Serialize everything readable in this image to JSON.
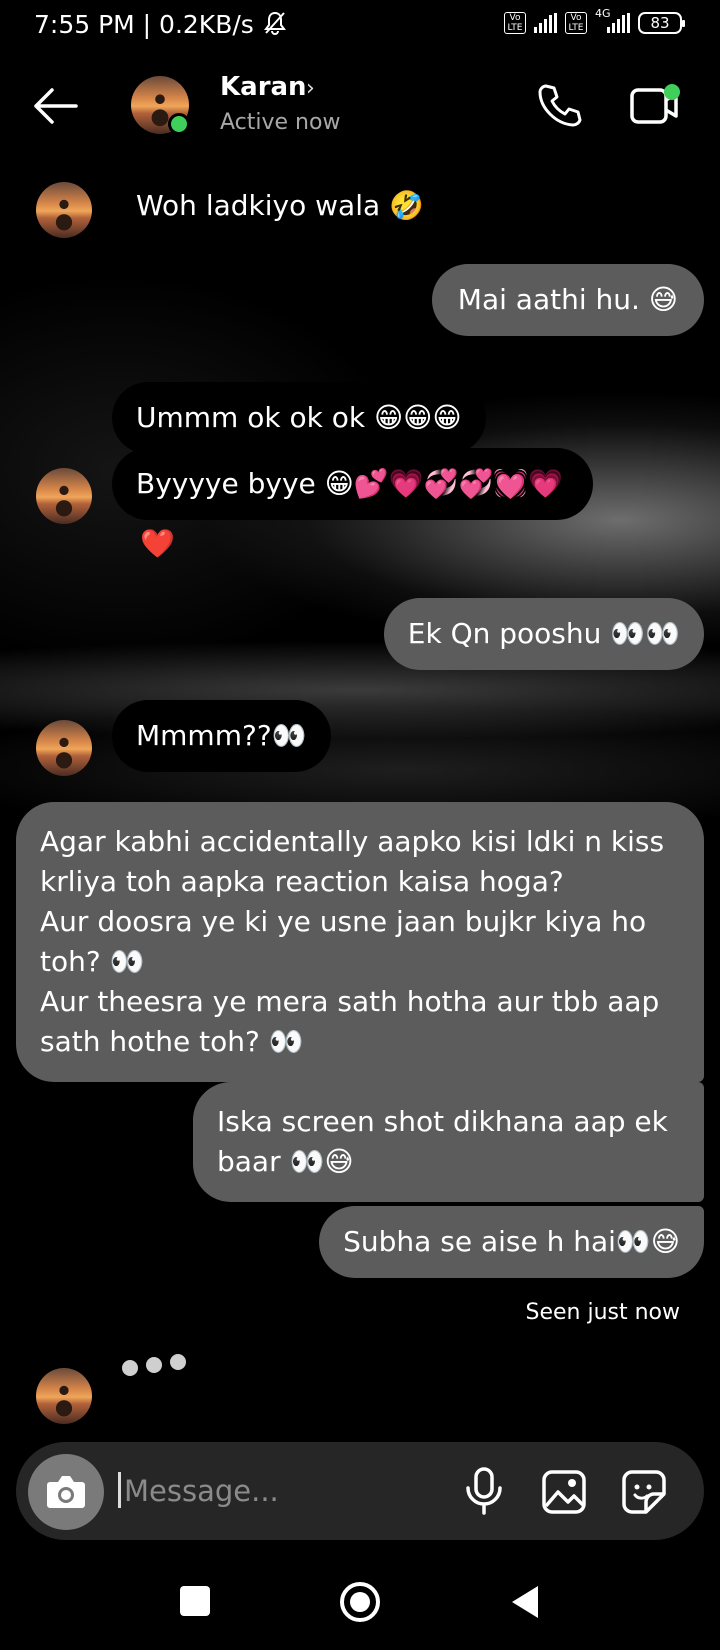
{
  "status_bar": {
    "time_speed": "7:55 PM | 0.2KB/s",
    "volte1": "Vo LTE",
    "volte2": "Vo LTE",
    "network_type": "4G",
    "battery": "83",
    "icons": [
      "bell-muted-icon",
      "signal-icon",
      "battery-icon"
    ]
  },
  "header": {
    "name": "Karan",
    "chevron": "›",
    "status": "Active now",
    "icons": [
      "back-arrow-icon",
      "phone-icon",
      "video-call-icon"
    ]
  },
  "messages": [
    {
      "side": "in",
      "text": "Woh ladkiyo wala 🤣",
      "avatar": true
    },
    {
      "side": "out",
      "text": "Mai aathi hu. 😅"
    },
    {
      "side": "in",
      "text": "Ummm ok ok ok 😁😁😁",
      "avatar": false
    },
    {
      "side": "in",
      "text": "Byyyye byye 😁💕💗💞💞💓💗",
      "avatar": true
    },
    {
      "side": "in",
      "text": "❤️",
      "avatar": false
    },
    {
      "side": "out",
      "text": "Ek Qn pooshu 👀👀"
    },
    {
      "side": "in",
      "text": "Mmmm??👀",
      "avatar": true
    },
    {
      "side": "out",
      "lines": [
        "Agar kabhi accidentally aapko kisi ldki n kiss",
        "krliya toh aapka reaction kaisa hoga?",
        "Aur doosra ye ki ye usne jaan bujkr kiya ho",
        "toh? 👀",
        "Aur theesra ye mera sath hotha aur tbb aap",
        "sath hothe toh? 👀"
      ]
    },
    {
      "side": "out",
      "lines": [
        "Iska screen shot dikhana aap ek",
        "baar 👀😅"
      ]
    },
    {
      "side": "out",
      "text": "Subha se aise h hai👀😅"
    }
  ],
  "seen_label": "Seen just now",
  "composer": {
    "placeholder": "Message...",
    "icons": [
      "camera-icon",
      "microphone-icon",
      "gallery-icon",
      "sticker-icon"
    ]
  },
  "nav": {
    "icons": [
      "recent-apps-icon",
      "home-icon",
      "back-icon"
    ]
  }
}
